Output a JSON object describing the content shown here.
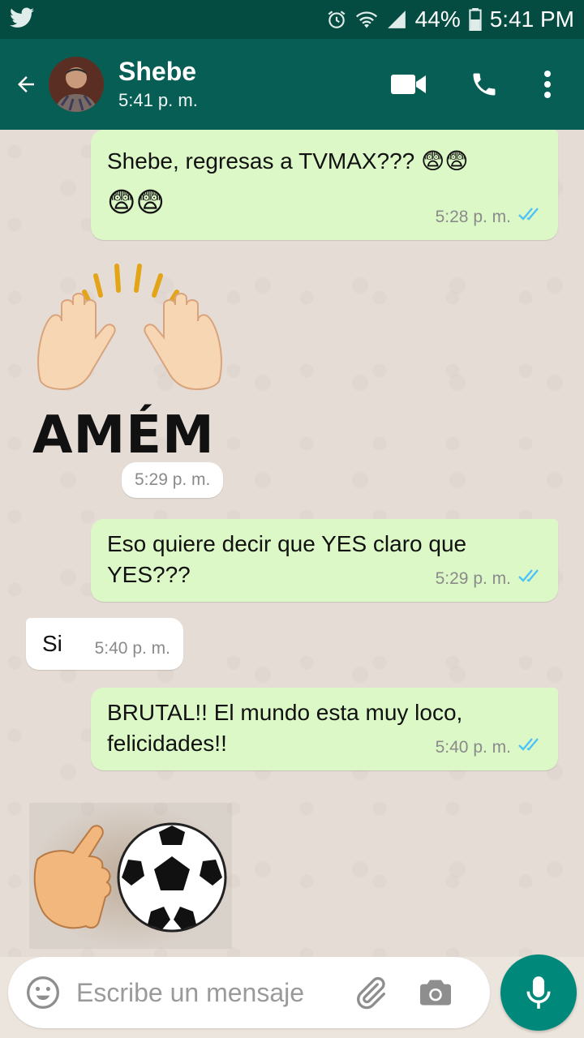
{
  "status_bar": {
    "battery": "44%",
    "time": "5:41 PM"
  },
  "header": {
    "contact_name": "Shebe",
    "subtitle": "5:41 p. m."
  },
  "messages": [
    {
      "direction": "out",
      "text": "Shebe, regresas a TVMAX??? 😨😨",
      "text2": "😨😨",
      "time": "5:28 p. m.",
      "status": "read"
    },
    {
      "direction": "in",
      "sticker": "amen",
      "sticker_text": "AMÉM",
      "time": "5:29 p. m."
    },
    {
      "direction": "out",
      "text": "Eso quiere decir que YES claro que",
      "text2": "YES???",
      "time": "5:29 p. m.",
      "status": "read"
    },
    {
      "direction": "in",
      "text": "Si",
      "time": "5:40 p. m."
    },
    {
      "direction": "out",
      "text": "BRUTAL!! El mundo esta muy loco,",
      "text2": "felicidades!!",
      "time": "5:40 p. m.",
      "status": "read"
    },
    {
      "direction": "in",
      "sticker": "call-me-soccer-ball"
    }
  ],
  "composer": {
    "placeholder": "Escribe un mensaje"
  },
  "colors": {
    "status_bar": "#044b41",
    "app_bar": "#075e54",
    "outgoing_bubble": "#dcf8c6",
    "incoming_bubble": "#ffffff",
    "read_ticks": "#4fc3f7",
    "mic_button": "#00897b"
  },
  "icons": {
    "status_left": "twitter-icon",
    "status_right": [
      "alarm-icon",
      "wifi-icon",
      "signal-icon",
      "battery-icon"
    ],
    "header": [
      "back-arrow-icon",
      "video-call-icon",
      "phone-icon",
      "more-vert-icon"
    ],
    "composer": [
      "emoji-icon",
      "attach-icon",
      "camera-icon",
      "mic-icon"
    ]
  }
}
